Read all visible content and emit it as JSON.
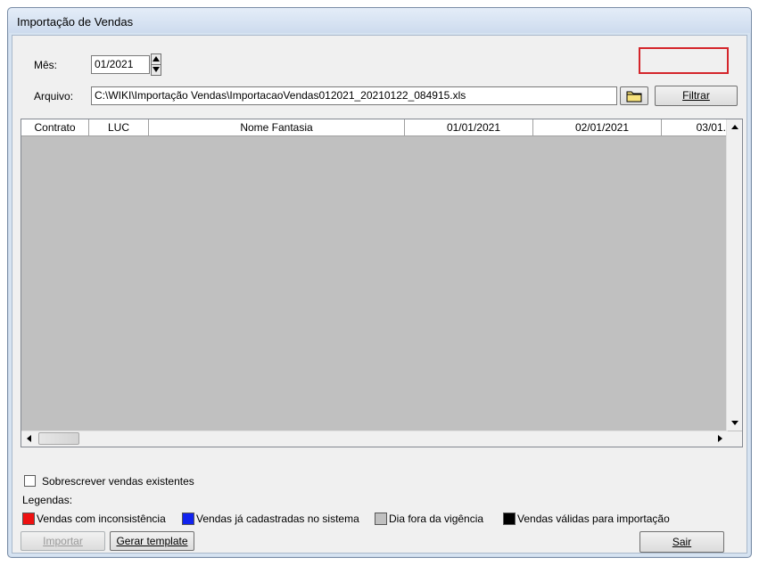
{
  "window": {
    "title": "Importação de Vendas"
  },
  "form": {
    "mes_label": "Mês:",
    "mes_value": "01/2021",
    "arquivo_label": "Arquivo:",
    "arquivo_value": "C:\\WIKI\\Importação Vendas\\ImportacaoVendas012021_20210122_084915.xls",
    "filtrar_label": "Filtrar"
  },
  "grid": {
    "columns": [
      "Contrato",
      "LUC",
      "Nome Fantasia",
      "01/01/2021",
      "02/01/2021",
      "03/01."
    ]
  },
  "options": {
    "sobrescrever_label": "Sobrescrever vendas existentes",
    "sobrescrever_checked": false
  },
  "legend": {
    "title": "Legendas:",
    "items": [
      {
        "label": "Vendas com inconsistência",
        "color": "#ee1111"
      },
      {
        "label": "Vendas já cadastradas no sistema",
        "color": "#1122ee"
      },
      {
        "label": "Dia fora da vigência",
        "color": "#c0c0c0"
      },
      {
        "label": "Vendas válidas para importação",
        "color": "#000000"
      }
    ]
  },
  "buttons": {
    "importar": "Importar",
    "gerar_template": "Gerar template",
    "sair": "Sair"
  },
  "icons": {
    "folder": "folder-icon",
    "spin": "spin-icon"
  }
}
